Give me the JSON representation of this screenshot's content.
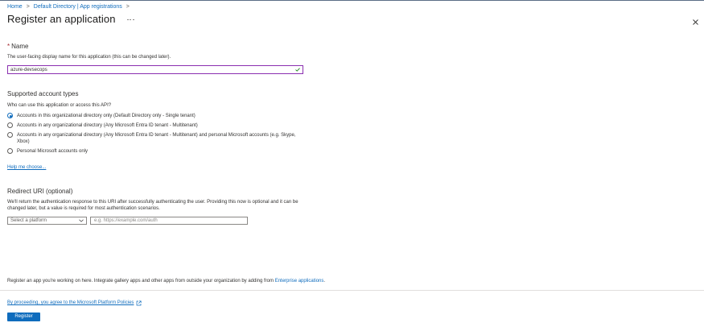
{
  "breadcrumb": {
    "items": [
      "Home",
      "Default Directory | App registrations"
    ],
    "separator": ">"
  },
  "page": {
    "title": "Register an application",
    "more_label": "...",
    "close_label": "Close"
  },
  "name_section": {
    "required_marker": "*",
    "title": "Name",
    "description": "The user-facing display name for this application (this can be changed later).",
    "input_value": "azure-devsecops",
    "input_valid": true
  },
  "account_types": {
    "title": "Supported account types",
    "question": "Who can use this application or access this API?",
    "options": [
      {
        "label": "Accounts in this organizational directory only (Default Directory only - Single tenant)",
        "checked": true
      },
      {
        "label": "Accounts in any organizational directory (Any Microsoft Entra ID tenant - Multitenant)",
        "checked": false
      },
      {
        "label": "Accounts in any organizational directory (Any Microsoft Entra ID tenant - Multitenant) and personal Microsoft accounts (e.g. Skype, Xbox)",
        "checked": false
      },
      {
        "label": "Personal Microsoft accounts only",
        "checked": false
      }
    ],
    "help_link": "Help me choose..."
  },
  "redirect": {
    "title": "Redirect URI (optional)",
    "description": "We'll return the authentication response to this URI after successfully authenticating the user. Providing this now is optional and it can be changed later, but a value is required for most authentication scenarios.",
    "platform_placeholder": "Select a platform",
    "uri_placeholder": "e.g. https://example.com/auth"
  },
  "footer": {
    "note_text": "Register an app you're working on here. Integrate gallery apps and other apps from outside your organization by adding from ",
    "note_link": "Enterprise applications",
    "note_end": ".",
    "policy_text": "By proceeding, you agree to the Microsoft Platform Policies",
    "register_label": "Register"
  },
  "colors": {
    "accent": "#0f6cbd",
    "focus_border": "#8a2fb0",
    "valid_check": "#107c10",
    "required": "#a4262c"
  },
  "icons": {
    "more": "ellipsis-icon",
    "close": "close-icon",
    "check": "checkmark-icon",
    "chevron": "chevron-down-icon",
    "external": "external-link-icon"
  }
}
